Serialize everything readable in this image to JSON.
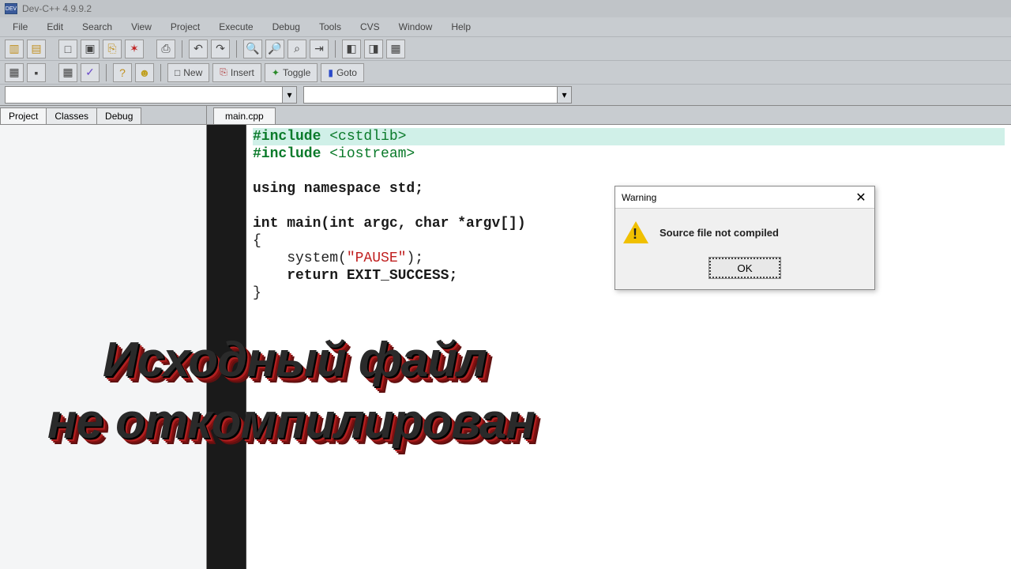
{
  "app": {
    "title": "Dev-C++ 4.9.9.2",
    "icon_label": "DEV"
  },
  "menu": [
    "File",
    "Edit",
    "Search",
    "View",
    "Project",
    "Execute",
    "Debug",
    "Tools",
    "CVS",
    "Window",
    "Help"
  ],
  "toolbar2": {
    "new": "New",
    "insert": "Insert",
    "toggle": "Toggle",
    "goto": "Goto"
  },
  "left_tabs": [
    "Project",
    "Classes",
    "Debug"
  ],
  "editor_tab": "main.cpp",
  "code": {
    "l1a": "#include ",
    "l1b": "<cstdlib>",
    "l2a": "#include ",
    "l2b": "<iostream>",
    "l3": "",
    "l4": "using namespace std;",
    "l5": "",
    "l6": "int main(int argc, char *argv[])",
    "l7": "{",
    "l8a": "    system(",
    "l8b": "\"PAUSE\"",
    "l8c": ");",
    "l9": "    return EXIT_SUCCESS;",
    "l10": "}"
  },
  "dialog": {
    "title": "Warning",
    "message": "Source file not compiled",
    "ok": "OK"
  },
  "overlay": {
    "line1": "Исходный файл",
    "line2": "не откомпилирован"
  }
}
